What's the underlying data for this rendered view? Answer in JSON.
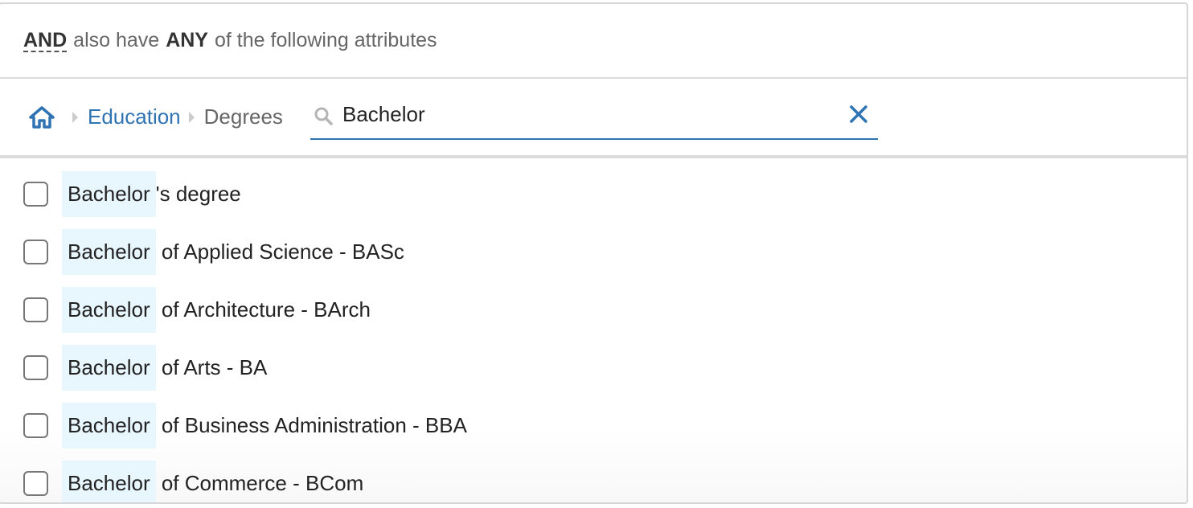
{
  "header": {
    "and": "AND",
    "middle": "also have",
    "any": "ANY",
    "rest": "of the following attributes"
  },
  "breadcrumb": {
    "home_icon": "home-icon",
    "items": [
      "Education",
      "Degrees"
    ]
  },
  "search": {
    "value": "Bachelor",
    "icon": "search-icon",
    "clear_icon": "close-icon"
  },
  "colors": {
    "accent": "#2f73b3",
    "highlight": "#e8f6fd"
  },
  "results": [
    {
      "match": "Bachelor",
      "rest": "'s degree",
      "checked": false
    },
    {
      "match": "Bachelor",
      "rest": " of Applied Science - BASc",
      "checked": false
    },
    {
      "match": "Bachelor",
      "rest": " of Architecture - BArch",
      "checked": false
    },
    {
      "match": "Bachelor",
      "rest": " of Arts - BA",
      "checked": false
    },
    {
      "match": "Bachelor",
      "rest": " of Business Administration - BBA",
      "checked": false
    },
    {
      "match": "Bachelor",
      "rest": " of Commerce - BCom",
      "checked": false
    }
  ]
}
